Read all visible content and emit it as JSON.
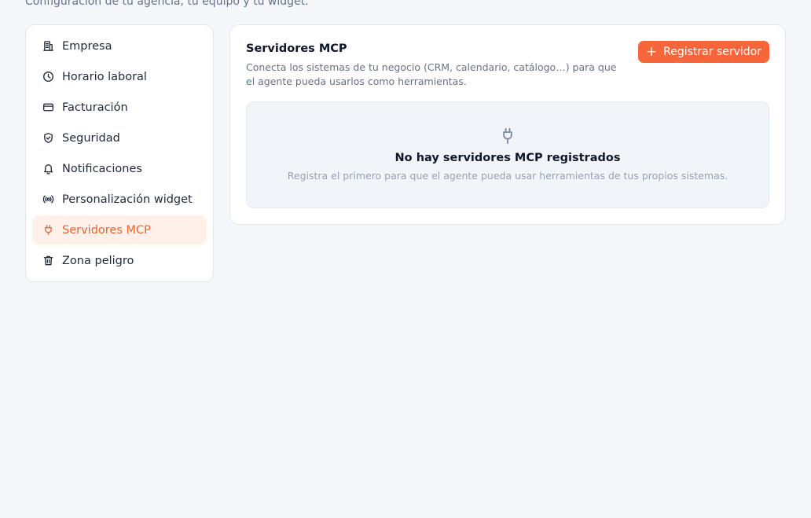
{
  "page": {
    "subtitle": "Configuración de tu agencia, tu equipo y tu widget."
  },
  "sidebar": {
    "items": [
      {
        "label": "Empresa",
        "icon": "building-icon",
        "active": false
      },
      {
        "label": "Horario laboral",
        "icon": "clock-icon",
        "active": false
      },
      {
        "label": "Facturación",
        "icon": "credit-card-icon",
        "active": false
      },
      {
        "label": "Seguridad",
        "icon": "shield-check-icon",
        "active": false
      },
      {
        "label": "Notificaciones",
        "icon": "bell-icon",
        "active": false
      },
      {
        "label": "Personalización widget",
        "icon": "broadcast-icon",
        "active": false
      },
      {
        "label": "Servidores MCP",
        "icon": "plug-icon",
        "active": true
      },
      {
        "label": "Zona peligro",
        "icon": "trash-icon",
        "active": false
      }
    ]
  },
  "panel": {
    "title": "Servidores MCP",
    "description": "Conecta los sistemas de tu negocio (CRM, calendario, catálogo…) para que el agente pueda usarlos como herramientas.",
    "register_button": "Registrar servidor",
    "empty_title": "No hay servidores MCP registrados",
    "empty_description": "Registra el primero para que el agente pueda usar herramientas de tus propios sistemas."
  },
  "colors": {
    "accent": "#f7653a",
    "active_bg": "#fff1ea",
    "background": "#f5f7fb"
  }
}
